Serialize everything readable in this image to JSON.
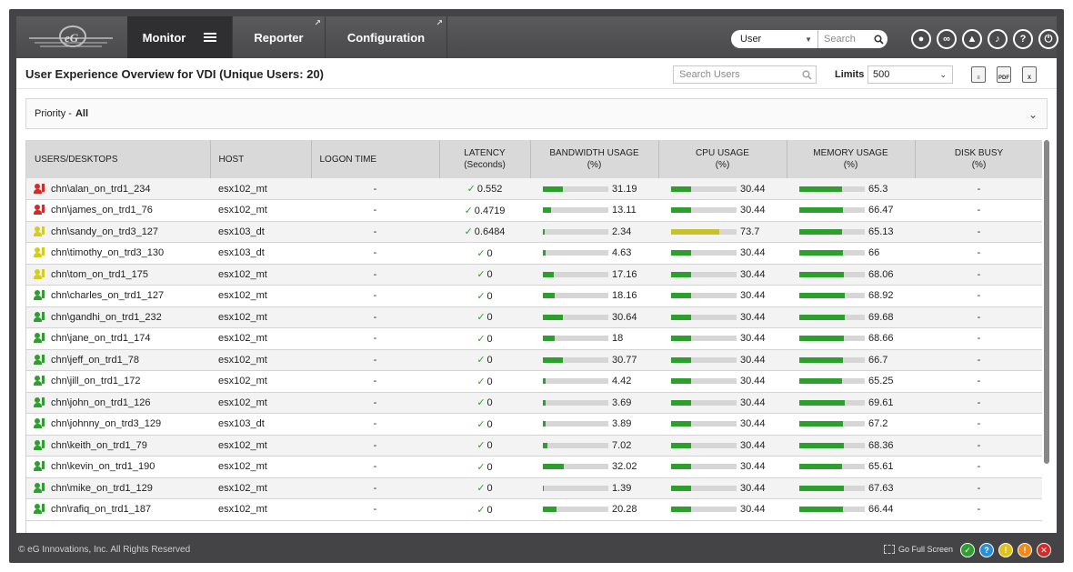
{
  "nav": {
    "tabs": [
      {
        "label": "Monitor"
      },
      {
        "label": "Reporter"
      },
      {
        "label": "Configuration"
      }
    ],
    "user_select": "User",
    "search_placeholder": "Search"
  },
  "page": {
    "title": "User Experience Overview for VDI (Unique Users: 20)",
    "search_users_placeholder": "Search Users",
    "limits_label": "Limits",
    "limits_value": "500",
    "priority_label": "Priority - ",
    "priority_value": "All"
  },
  "table": {
    "headers": {
      "users": "USERS/DESKTOPS",
      "host": "HOST",
      "logon": "LOGON TIME",
      "latency": "LATENCY",
      "latency_unit": "(Seconds)",
      "bandwidth": "BANDWIDTH USAGE",
      "bandwidth_unit": "(%)",
      "cpu": "CPU USAGE",
      "cpu_unit": "(%)",
      "memory": "MEMORY USAGE",
      "memory_unit": "(%)",
      "disk": "DISK BUSY",
      "disk_unit": "(%)"
    },
    "rows": [
      {
        "user": "chn\\alan_on_trd1_234",
        "host": "esx102_mt",
        "logon": "-",
        "latency": "0.552",
        "bandwidth": "31.19",
        "cpu": "30.44",
        "memory": "65.3",
        "disk": "-",
        "status": "red"
      },
      {
        "user": "chn\\james_on_trd1_76",
        "host": "esx102_mt",
        "logon": "-",
        "latency": "0.4719",
        "bandwidth": "13.11",
        "cpu": "30.44",
        "memory": "66.47",
        "disk": "-",
        "status": "red"
      },
      {
        "user": "chn\\sandy_on_trd3_127",
        "host": "esx103_dt",
        "logon": "-",
        "latency": "0.6484",
        "bandwidth": "2.34",
        "cpu": "73.7",
        "memory": "65.13",
        "disk": "-",
        "status": "yellow"
      },
      {
        "user": "chn\\timothy_on_trd3_130",
        "host": "esx103_dt",
        "logon": "-",
        "latency": "0",
        "bandwidth": "4.63",
        "cpu": "30.44",
        "memory": "66",
        "disk": "-",
        "status": "yellow"
      },
      {
        "user": "chn\\tom_on_trd1_175",
        "host": "esx102_mt",
        "logon": "-",
        "latency": "0",
        "bandwidth": "17.16",
        "cpu": "30.44",
        "memory": "68.06",
        "disk": "-",
        "status": "yellow"
      },
      {
        "user": "chn\\charles_on_trd1_127",
        "host": "esx102_mt",
        "logon": "-",
        "latency": "0",
        "bandwidth": "18.16",
        "cpu": "30.44",
        "memory": "68.92",
        "disk": "-",
        "status": "green"
      },
      {
        "user": "chn\\gandhi_on_trd1_232",
        "host": "esx102_mt",
        "logon": "-",
        "latency": "0",
        "bandwidth": "30.64",
        "cpu": "30.44",
        "memory": "69.68",
        "disk": "-",
        "status": "green"
      },
      {
        "user": "chn\\jane_on_trd1_174",
        "host": "esx102_mt",
        "logon": "-",
        "latency": "0",
        "bandwidth": "18",
        "cpu": "30.44",
        "memory": "68.66",
        "disk": "-",
        "status": "green"
      },
      {
        "user": "chn\\jeff_on_trd1_78",
        "host": "esx102_mt",
        "logon": "-",
        "latency": "0",
        "bandwidth": "30.77",
        "cpu": "30.44",
        "memory": "66.7",
        "disk": "-",
        "status": "green"
      },
      {
        "user": "chn\\jill_on_trd1_172",
        "host": "esx102_mt",
        "logon": "-",
        "latency": "0",
        "bandwidth": "4.42",
        "cpu": "30.44",
        "memory": "65.25",
        "disk": "-",
        "status": "green"
      },
      {
        "user": "chn\\john_on_trd1_126",
        "host": "esx102_mt",
        "logon": "-",
        "latency": "0",
        "bandwidth": "3.69",
        "cpu": "30.44",
        "memory": "69.61",
        "disk": "-",
        "status": "green"
      },
      {
        "user": "chn\\johnny_on_trd3_129",
        "host": "esx103_dt",
        "logon": "-",
        "latency": "0",
        "bandwidth": "3.89",
        "cpu": "30.44",
        "memory": "67.2",
        "disk": "-",
        "status": "green"
      },
      {
        "user": "chn\\keith_on_trd1_79",
        "host": "esx102_mt",
        "logon": "-",
        "latency": "0",
        "bandwidth": "7.02",
        "cpu": "30.44",
        "memory": "68.36",
        "disk": "-",
        "status": "green"
      },
      {
        "user": "chn\\kevin_on_trd1_190",
        "host": "esx102_mt",
        "logon": "-",
        "latency": "0",
        "bandwidth": "32.02",
        "cpu": "30.44",
        "memory": "65.61",
        "disk": "-",
        "status": "green"
      },
      {
        "user": "chn\\mike_on_trd1_129",
        "host": "esx102_mt",
        "logon": "-",
        "latency": "0",
        "bandwidth": "1.39",
        "cpu": "30.44",
        "memory": "67.63",
        "disk": "-",
        "status": "green"
      },
      {
        "user": "chn\\rafiq_on_trd1_187",
        "host": "esx102_mt",
        "logon": "-",
        "latency": "0",
        "bandwidth": "20.28",
        "cpu": "30.44",
        "memory": "66.44",
        "disk": "-",
        "status": "green"
      }
    ]
  },
  "footer": {
    "copyright": "© eG Innovations, Inc. All Rights Reserved",
    "fullscreen": "Go Full Screen"
  },
  "colors": {
    "status_red": "#d42a2a",
    "status_yellow": "#d6cc1e",
    "status_green": "#2e9e2e",
    "bar_green": "#2ca02c",
    "bar_yellow": "#c9c12a"
  }
}
